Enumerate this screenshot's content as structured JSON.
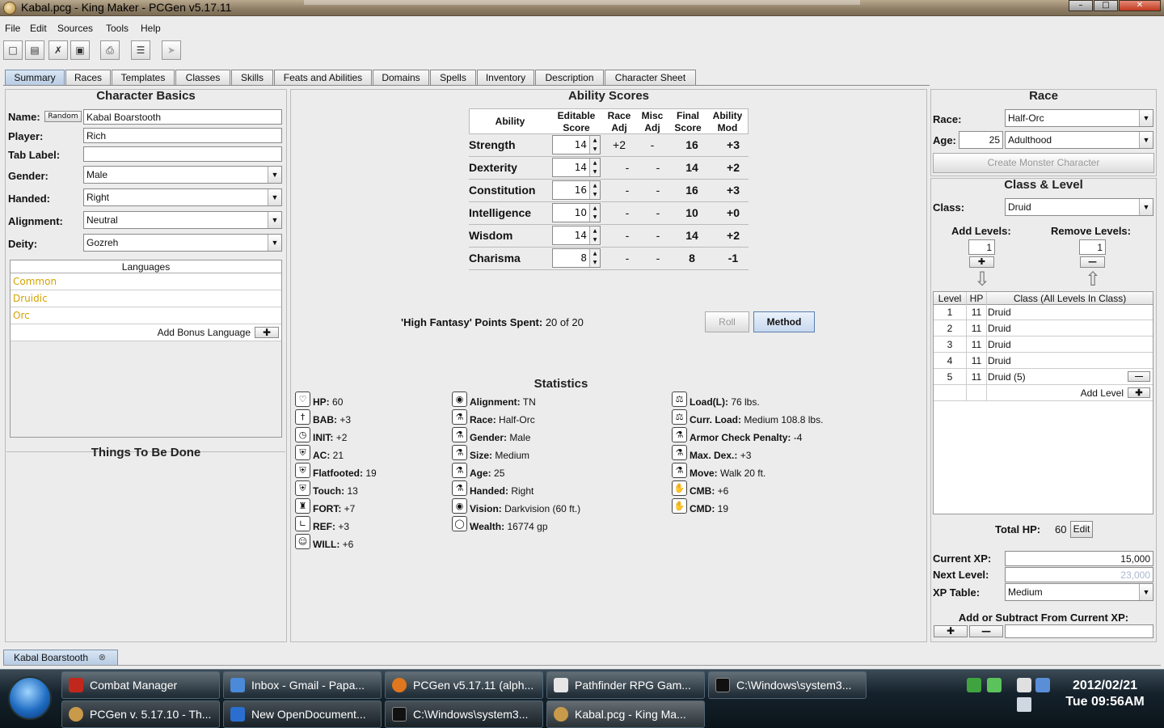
{
  "window": {
    "title": "Kabal.pcg - King Maker - PCGen v5.17.11",
    "minimize": "–",
    "maximize": "□",
    "close": "✕"
  },
  "menu": [
    "File",
    "Edit",
    "Sources",
    "Tools",
    "Help"
  ],
  "toolbar_icons": [
    "new-icon",
    "open-icon",
    "close-file-icon",
    "save-icon",
    "print-icon",
    "preferences-icon",
    "cursor-icon"
  ],
  "tabs": [
    "Summary",
    "Races",
    "Templates",
    "Classes",
    "Skills",
    "Feats and Abilities",
    "Domains",
    "Spells",
    "Inventory",
    "Description",
    "Character Sheet"
  ],
  "basics": {
    "title": "Character Basics",
    "name_label": "Name:",
    "random": "Random",
    "name": "Kabal Boarstooth",
    "player_label": "Player:",
    "player": "Rich",
    "tab_label_label": "Tab Label:",
    "tab_label": "",
    "gender_label": "Gender:",
    "gender": "Male",
    "handed_label": "Handed:",
    "handed": "Right",
    "alignment_label": "Alignment:",
    "alignment": "Neutral",
    "deity_label": "Deity:",
    "deity": "Gozreh",
    "languages_title": "Languages",
    "languages": [
      "Common",
      "Druidic",
      "Orc"
    ],
    "add_bonus_language": "Add Bonus Language",
    "todo_title": "Things To Be Done"
  },
  "abilities": {
    "title": "Ability Scores",
    "headers": {
      "ability": "Ability",
      "editable": "Editable",
      "score": "Score",
      "race": "Race",
      "adj": "Adj",
      "misc": "Misc",
      "misc_adj": "Adj",
      "final": "Final",
      "final_score": "Score",
      "ability_mod": "Ability",
      "mod": "Mod"
    },
    "rows": [
      {
        "name": "Strength",
        "score": "14",
        "race": "+2",
        "misc": "-",
        "final": "16",
        "mod": "+3"
      },
      {
        "name": "Dexterity",
        "score": "14",
        "race": "-",
        "misc": "-",
        "final": "14",
        "mod": "+2"
      },
      {
        "name": "Constitution",
        "score": "16",
        "race": "-",
        "misc": "-",
        "final": "16",
        "mod": "+3"
      },
      {
        "name": "Intelligence",
        "score": "10",
        "race": "-",
        "misc": "-",
        "final": "10",
        "mod": "+0"
      },
      {
        "name": "Wisdom",
        "score": "14",
        "race": "-",
        "misc": "-",
        "final": "14",
        "mod": "+2"
      },
      {
        "name": "Charisma",
        "score": "8",
        "race": "-",
        "misc": "-",
        "final": "8",
        "mod": "-1"
      }
    ],
    "points_label": "'High Fantasy' Points Spent:",
    "points_value": "20 of 20",
    "roll": "Roll",
    "method": "Method"
  },
  "stats": {
    "title": "Statistics",
    "col1": [
      {
        "label": "HP:",
        "value": "60",
        "icon": "heart-icon"
      },
      {
        "label": "BAB:",
        "value": "+3",
        "icon": "sword-icon"
      },
      {
        "label": "INIT:",
        "value": "+2",
        "icon": "clock-icon"
      },
      {
        "label": "AC:",
        "value": "21",
        "icon": "shield-icon"
      },
      {
        "label": "Flatfooted:",
        "value": "19",
        "icon": "shield-icon"
      },
      {
        "label": "Touch:",
        "value": "13",
        "icon": "shield-icon"
      },
      {
        "label": "FORT:",
        "value": "+7",
        "icon": "tower-icon"
      },
      {
        "label": "REF:",
        "value": "+3",
        "icon": "boot-icon"
      },
      {
        "label": "WILL:",
        "value": "+6",
        "icon": "head-icon"
      }
    ],
    "col2": [
      {
        "label": "Alignment:",
        "value": "TN",
        "icon": "eye-icon"
      },
      {
        "label": "Race:",
        "value": " Half-Orc",
        "icon": "person-icon"
      },
      {
        "label": "Gender:",
        "value": "Male",
        "icon": "person-icon"
      },
      {
        "label": "Size:",
        "value": "Medium",
        "icon": "person-icon"
      },
      {
        "label": "Age:",
        "value": "25",
        "icon": "people-icon"
      },
      {
        "label": "Handed:",
        "value": "Right",
        "icon": "person-icon"
      },
      {
        "label": "Vision:",
        "value": "Darkvision (60 ft.)",
        "icon": "eye-icon"
      },
      {
        "label": "Wealth:",
        "value": "16774 gp",
        "icon": "coins-icon"
      }
    ],
    "col3": [
      {
        "label": "Load(L):",
        "value": "76 lbs.",
        "icon": "weight-icon"
      },
      {
        "label": "Curr. Load:",
        "value": "Medium 108.8 lbs.",
        "icon": "weight-icon"
      },
      {
        "label": "Armor Check Penalty:",
        "value": "-4",
        "icon": "person-icon"
      },
      {
        "label": "Max. Dex.:",
        "value": "+3",
        "icon": "person-icon"
      },
      {
        "label": "Move:",
        "value": "Walk 20 ft.",
        "icon": "person-icon"
      },
      {
        "label": "CMB:",
        "value": "+6",
        "icon": "fist-icon"
      },
      {
        "label": "CMD:",
        "value": "19",
        "icon": "fist-icon"
      }
    ]
  },
  "race": {
    "title": "Race",
    "race_label": "Race:",
    "race": "Half-Orc",
    "age_label": "Age:",
    "age": "25",
    "age_category": "Adulthood",
    "monster_button": "Create Monster Character"
  },
  "class_level": {
    "title": "Class & Level",
    "class_label": "Class:",
    "class": "Druid",
    "add_label": "Add Levels:",
    "add_value": "1",
    "remove_label": "Remove Levels:",
    "remove_value": "1",
    "headers": {
      "level": "Level",
      "hp": "HP",
      "class": "Class (All Levels In Class)"
    },
    "rows": [
      {
        "level": "1",
        "hp": "11",
        "class": "Druid"
      },
      {
        "level": "2",
        "hp": "11",
        "class": "Druid"
      },
      {
        "level": "3",
        "hp": "11",
        "class": "Druid"
      },
      {
        "level": "4",
        "hp": "11",
        "class": "Druid"
      },
      {
        "level": "5",
        "hp": "11",
        "class": "Druid (5)"
      }
    ],
    "add_level": "Add Level",
    "total_hp_label": "Total HP:",
    "total_hp": "60",
    "edit": "Edit",
    "current_xp_label": "Current XP:",
    "current_xp": "15,000",
    "next_level_label": "Next Level:",
    "next_level": "23,000",
    "xp_table_label": "XP Table:",
    "xp_table": "Medium",
    "add_sub_label": "Add or Subtract From Current XP:"
  },
  "document_tab": "Kabal Boarstooth",
  "taskbar": {
    "row1": [
      "Combat Manager",
      "Inbox - Gmail - Papa...",
      "PCGen v5.17.11 (alph...",
      "Pathfinder RPG Gam...",
      "C:\\Windows\\system3..."
    ],
    "row2": [
      "PCGen v. 5.17.10 - Th...",
      "New OpenDocument...",
      "C:\\Windows\\system3...",
      "Kabal.pcg - King Ma..."
    ],
    "date": "2012/02/21",
    "time": "Tue 09:56AM"
  }
}
